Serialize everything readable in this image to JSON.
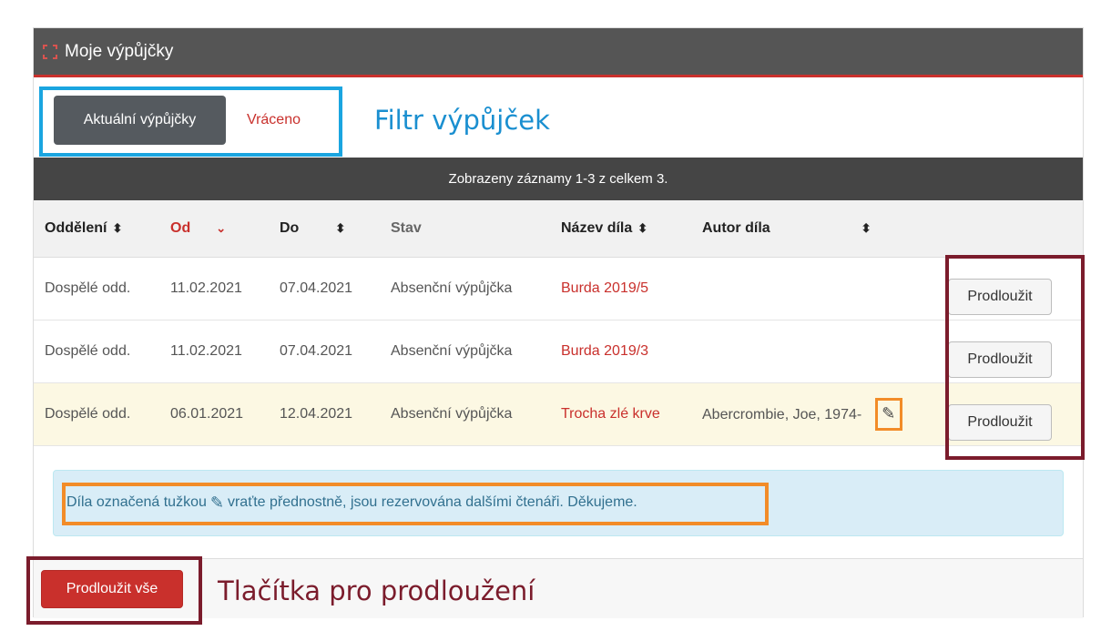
{
  "header": {
    "title": "Moje výpůjčky"
  },
  "filter": {
    "active_label": "Aktuální výpůjčky",
    "returned_label": "Vráceno",
    "annotation": "Filtr výpůjček"
  },
  "records_info": "Zobrazeny záznamy 1-3 z celkem 3.",
  "table": {
    "columns": [
      "Oddělení",
      "Od",
      "Do",
      "Stav",
      "Název díla",
      "Autor díla"
    ],
    "rows": [
      {
        "department": "Dospělé odd.",
        "from": "11.02.2021",
        "to": "07.04.2021",
        "status": "Absenční výpůjčka",
        "title": "Burda 2019/5",
        "author": "",
        "reserved": false,
        "renew_label": "Prodloužit"
      },
      {
        "department": "Dospělé odd.",
        "from": "11.02.2021",
        "to": "07.04.2021",
        "status": "Absenční výpůjčka",
        "title": "Burda 2019/3",
        "author": "",
        "reserved": false,
        "renew_label": "Prodloužit"
      },
      {
        "department": "Dospělé odd.",
        "from": "06.01.2021",
        "to": "12.04.2021",
        "status": "Absenční výpůjčka",
        "title": "Trocha zlé krve",
        "author": "Abercrombie, Joe, 1974-",
        "reserved": true,
        "renew_label": "Prodloužit"
      }
    ]
  },
  "alert": {
    "text_before": "Díla označená tužkou",
    "text_after": "vraťte přednostně, jsou rezervována dalšími čtenáři. Děkujeme."
  },
  "footer": {
    "renew_all_label": "Prodloužit vše",
    "annotation": "Tlačítka pro prodloužení"
  },
  "colors": {
    "accent_red": "#c9302c",
    "header_bg": "#555555",
    "callout_blue": "#1aa5e0",
    "callout_orange": "#f28c28",
    "callout_darkred": "#7b1c2c"
  }
}
